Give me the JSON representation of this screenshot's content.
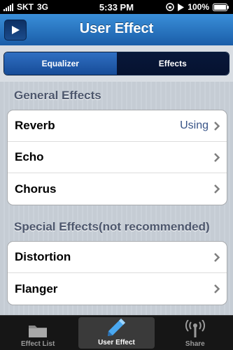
{
  "status_bar": {
    "carrier": "SKT",
    "network": "3G",
    "time": "5:33 PM",
    "battery": "100%"
  },
  "nav": {
    "title": "User Effect",
    "left_button_icon": "play-icon"
  },
  "segments": [
    {
      "label": "Equalizer",
      "selected": true
    },
    {
      "label": "Effects",
      "selected": false
    }
  ],
  "sections": [
    {
      "header": "General Effects",
      "rows": [
        {
          "label": "Reverb",
          "value": "Using"
        },
        {
          "label": "Echo",
          "value": ""
        },
        {
          "label": "Chorus",
          "value": ""
        }
      ]
    },
    {
      "header": "Special Effects(not recommended)",
      "rows": [
        {
          "label": "Distortion",
          "value": ""
        },
        {
          "label": "Flanger",
          "value": ""
        }
      ]
    }
  ],
  "tabs": [
    {
      "label": "Effect List",
      "icon": "folder-icon",
      "selected": false
    },
    {
      "label": "User Effect",
      "icon": "pen-icon",
      "selected": true
    },
    {
      "label": "Share",
      "icon": "antenna-icon",
      "selected": false
    }
  ],
  "colors": {
    "nav_blue": "#1a5da8",
    "segment_active": "#2f6fc2",
    "value_text": "#385487"
  }
}
